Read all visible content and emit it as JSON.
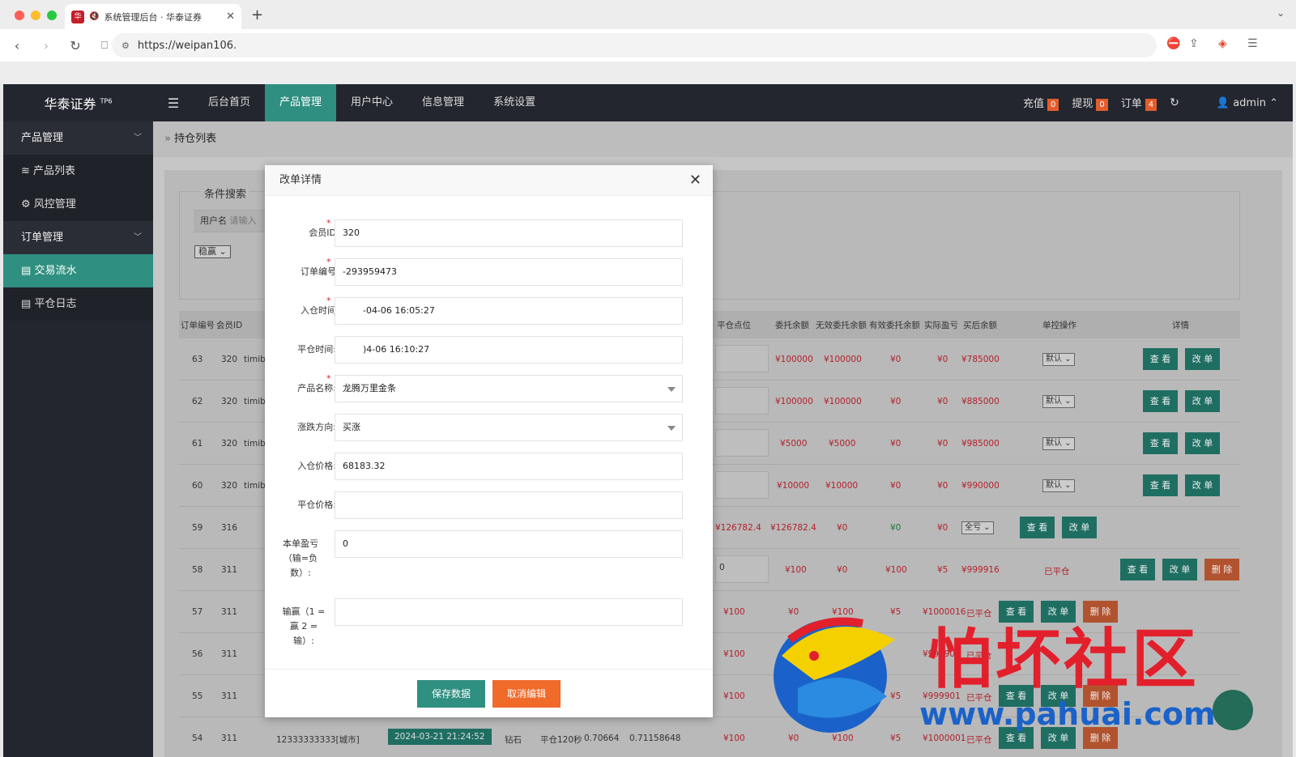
{
  "browser": {
    "tab_title": "系统管理后台 · 华泰证券",
    "tab_favicon": "华",
    "url": "https://weipan106.",
    "colors": {
      "dot_red": "#ff5f57",
      "dot_yellow": "#febc2e",
      "dot_green": "#28c840"
    }
  },
  "header": {
    "brand": "华泰证券",
    "brand_sup": "TP6",
    "nav": [
      "后台首页",
      "产品管理",
      "用户中心",
      "信息管理",
      "系统设置"
    ],
    "recharge_label": "充值",
    "recharge_count": "0",
    "withdraw_label": "提现",
    "withdraw_count": "0",
    "order_label": "订单",
    "order_count": "4",
    "user": "admin"
  },
  "sidebar": {
    "group1": "产品管理",
    "item1": "产品列表",
    "item2": "风控管理",
    "group2": "订单管理",
    "item3": "交易流水",
    "item4": "平仓日志"
  },
  "content": {
    "breadcrumb": "持仓列表",
    "search_title": "条件搜索",
    "search_user_label": "用户名",
    "search_user_placeholder": "请输入",
    "filter_value": "稳赢"
  },
  "table": {
    "headers": {
      "id": "订单编号",
      "member": "会员ID",
      "close_point": "平仓点位",
      "entrust": "委托余额",
      "invalid": "无效委托余额",
      "valid": "有效委托余额",
      "pnl": "实际盈亏",
      "after": "买后余额",
      "ctrl": "单控操作",
      "detail": "详情"
    },
    "view": "查 看",
    "edit": "改 单",
    "delete": "删 除",
    "closed": "已平仓",
    "rows": [
      {
        "id": "63",
        "member": "320",
        "user": "timibb",
        "entrust": "¥100000",
        "invalid": "¥100000",
        "valid": "¥0",
        "pnl": "¥0",
        "after": "¥785000",
        "ctrl": "默认"
      },
      {
        "id": "62",
        "member": "320",
        "user": "timibb",
        "entrust": "¥100000",
        "invalid": "¥100000",
        "valid": "¥0",
        "pnl": "¥0",
        "after": "¥885000",
        "ctrl": "默认"
      },
      {
        "id": "61",
        "member": "320",
        "user": "timibb",
        "entrust": "¥5000",
        "invalid": "¥5000",
        "valid": "¥0",
        "pnl": "¥0",
        "after": "¥985000",
        "ctrl": "默认"
      },
      {
        "id": "60",
        "member": "320",
        "user": "timibb",
        "entrust": "¥10000",
        "invalid": "¥10000",
        "valid": "¥0",
        "pnl": "¥0",
        "after": "¥990000",
        "ctrl": "默认"
      },
      {
        "id": "59",
        "member": "316",
        "point": "¥126782.4",
        "entrust": "¥126782.4",
        "invalid": "¥0",
        "valid": "¥0",
        "pnl": "¥0",
        "ctrl": "全亏"
      },
      {
        "id": "58",
        "member": "311",
        "point": "0",
        "entrust": "¥100",
        "invalid": "¥0",
        "valid": "¥100",
        "pnl": "¥5",
        "after": "¥999916"
      },
      {
        "id": "57",
        "member": "311",
        "entrust": "¥100",
        "invalid": "¥0",
        "valid": "¥100",
        "pnl": "¥5",
        "after": "¥1000016"
      },
      {
        "id": "56",
        "member": "311",
        "entrust": "¥100",
        "after": "¥999901"
      },
      {
        "id": "55",
        "member": "311",
        "entrust": "¥100",
        "pnl": "¥5",
        "after": "¥999901"
      },
      {
        "id": "54",
        "member": "311",
        "phone": "12333333333[城市]",
        "time": "2024-03-21 21:24:52",
        "level": "钻石",
        "mode": "平仓120秒",
        "in_price": "0.70664",
        "out_price": "0.71158648",
        "entrust": "¥100",
        "invalid": "¥0",
        "valid": "¥100",
        "pnl": "¥5",
        "after": "¥1000001"
      }
    ]
  },
  "modal": {
    "title": "改单详情",
    "fields": {
      "member_id_label": "会员ID",
      "member_id": "320",
      "order_no_label": "订单编号",
      "order_no": "-293959473",
      "open_time_label": "入仓时间",
      "open_time": "-04-06 16:05:27",
      "close_time_label": "平仓时间:",
      "close_time": ")4-06 16:10:27",
      "product_label": "产品名称:",
      "product": "龙腾万里金条",
      "direction_label": "涨跌方向:",
      "direction": "买涨",
      "open_price_label": "入仓价格:",
      "open_price": "68183.32",
      "close_price_label": "平仓价格:",
      "close_price": "",
      "pnl_label": "本单盈亏（输=负数）:",
      "pnl": "0",
      "winlose_label": "输赢（1 = 赢 2 = 输）:",
      "winlose": ""
    },
    "save": "保存数据",
    "cancel": "取消编辑"
  },
  "watermark": {
    "text": "怕坏社区",
    "url": "www.pahuai.com"
  }
}
